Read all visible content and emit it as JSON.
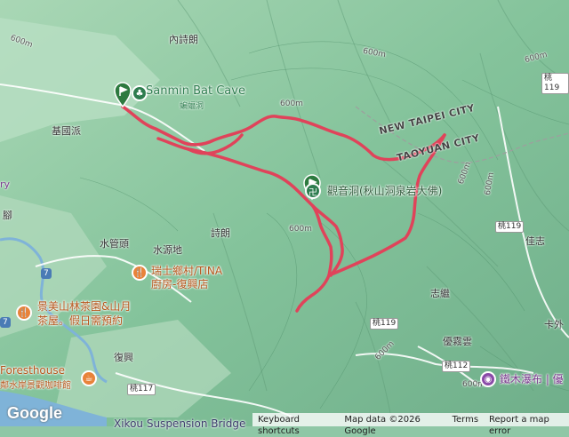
{
  "map": {
    "places": {
      "neishilang": "內詩朗",
      "jiyuanpai": "基國派",
      "shuiguantou": "水管頭",
      "shuiyuandi": "水源地",
      "shilang": "詩朗",
      "zhijiang": "志繼",
      "jiazhi": "佳志",
      "kawai": "卡外",
      "fuxing": "復興",
      "youwuyun": "優霧雲",
      "left_edge_1": "ry",
      "left_edge_2": "腳"
    },
    "pois": {
      "bat_cave": "Sanmin Bat Cave",
      "bat_cave_zh": "蝙蝠洞",
      "guanyin_cave": "觀音洞(秋山洞泉岩大佛)",
      "ruishi_1": "瑞士鄉村/TINA",
      "ruishi_2": "廚房-復興店",
      "jingmei_1": "景美山林茶園&山月",
      "jingmei_2": "茶屋。假日需預約",
      "foresthouse_1": "Foresthouse",
      "foresthouse_2": "鄰水岸景觀咖啡館",
      "tiemu_waterfall": "鐵木瀑布 | 優",
      "xikou_bridge": "Xikou Suspension Bridge"
    },
    "admin": {
      "new_taipei": "NEW TAIPEI CITY",
      "taoyuan": "TAOYUAN CITY"
    },
    "roads": {
      "r7a": "7",
      "r7b": "7",
      "tao119a": "桃119",
      "tao119b": "桃119",
      "tao119c": "桃119",
      "tao112": "桃112",
      "tao117": "桃117"
    },
    "contours": {
      "c1": "600m",
      "c2": "600m",
      "c3": "600m",
      "c4": "600m",
      "c5": "600m",
      "c6": "600m",
      "c7": "600m",
      "c8": "600m",
      "c9": "600m"
    },
    "route_color": "#e0435a",
    "marker_color": "#2d7a3f"
  },
  "footer": {
    "logo": "Google",
    "keyboard": "Keyboard shortcuts",
    "mapdata": "Map data ©2026 Google",
    "terms": "Terms",
    "report": "Report a map error"
  }
}
